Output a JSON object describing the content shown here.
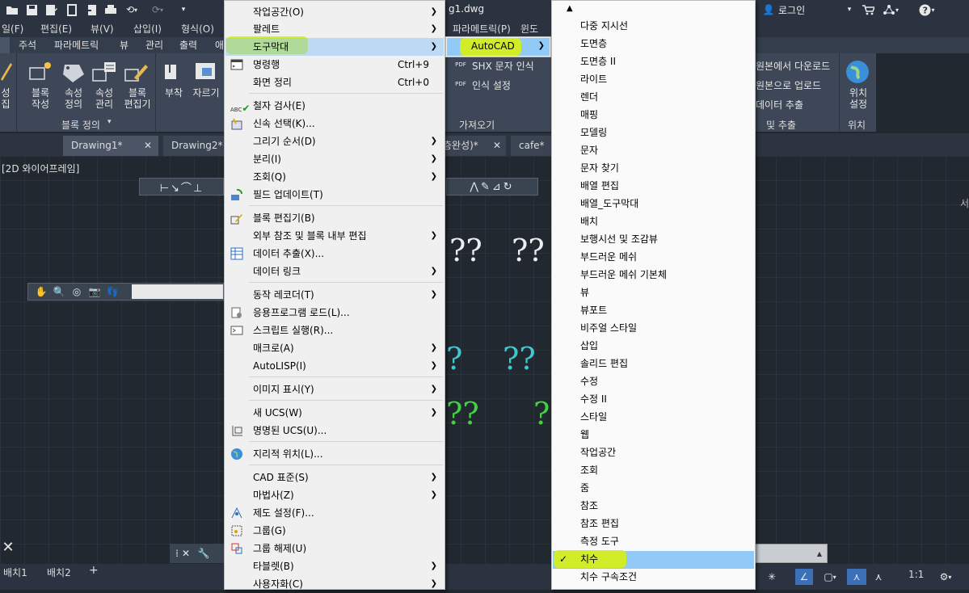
{
  "quickaccess": {
    "icons": [
      "open-icon",
      "save-icon",
      "saveas-icon",
      "export-icon",
      "publish-icon",
      "print-icon",
      "undo-icon",
      "redo-icon",
      "customize-icon"
    ]
  },
  "titlebar": {
    "filename": "g1.dwg",
    "login": "로그인"
  },
  "menubar": {
    "items": [
      "일(F)",
      "편집(E)",
      "뷰(V)",
      "삽입(I)",
      "형식(O)"
    ],
    "right_items": [
      "파라메트릭(P)",
      "윈도"
    ]
  },
  "ribbon_tabs": [
    "주석",
    "파라메트릭",
    "뷰",
    "관리",
    "출력",
    "애"
  ],
  "ribbon": {
    "left_cut": "성\n집",
    "block_group": {
      "buttons": [
        "블록\n작성",
        "속성\n정의",
        "속성\n관리",
        "블록\n편집기"
      ],
      "title": "블록 정의"
    },
    "ref_buttons": [
      "부착",
      "자르기"
    ],
    "import_group": {
      "items": [
        "SHX 문자 인식",
        "인식 설정"
      ],
      "title": "가져오기"
    },
    "data_group": {
      "items": [
        "원본에서 다운로드",
        "원본으로 업로드",
        "데이터 추출"
      ],
      "title": "및 추출"
    },
    "location_group": {
      "button": "위치\n설정",
      "title": "위치"
    }
  },
  "doc_tabs": [
    "Drawing1*",
    "Drawing2*",
    "층완성)*",
    "cafe*"
  ],
  "viewport_label": "[2D 와이어프레임]",
  "layout_tabs": [
    "배치1",
    "배치2"
  ],
  "status": {
    "scale": "1:1"
  },
  "menu1": {
    "items": [
      {
        "label": "작업공간(O)",
        "arrow": true
      },
      {
        "label": "팔레트",
        "arrow": true
      },
      {
        "label": "도구막대",
        "arrow": true,
        "highlight": true
      },
      {
        "label": "명령행",
        "shortcut": "Ctrl+9"
      },
      {
        "label": "화면 정리",
        "shortcut": "Ctrl+0"
      },
      {
        "label": "철자 검사(E)"
      },
      {
        "label": "신속 선택(K)..."
      },
      {
        "label": "그리기 순서(D)",
        "arrow": true
      },
      {
        "label": "분리(I)",
        "arrow": true
      },
      {
        "label": "조회(Q)",
        "arrow": true
      },
      {
        "label": "필드 업데이트(T)"
      },
      {
        "label": "블록 편집기(B)"
      },
      {
        "label": "외부 참조 및 블록 내부 편집",
        "arrow": true
      },
      {
        "label": "데이터 추출(X)..."
      },
      {
        "label": "데이터 링크",
        "arrow": true
      },
      {
        "label": "동작 레코더(T)",
        "arrow": true
      },
      {
        "label": "응용프로그램 로드(L)..."
      },
      {
        "label": "스크립트 실행(R)..."
      },
      {
        "label": "매크로(A)",
        "arrow": true
      },
      {
        "label": "AutoLISP(I)",
        "arrow": true
      },
      {
        "label": "이미지 표시(Y)",
        "arrow": true
      },
      {
        "label": "새 UCS(W)",
        "arrow": true
      },
      {
        "label": "명명된 UCS(U)..."
      },
      {
        "label": "지리적 위치(L)..."
      },
      {
        "label": "CAD 표준(S)",
        "arrow": true
      },
      {
        "label": "마법사(Z)",
        "arrow": true
      },
      {
        "label": "제도 설정(F)..."
      },
      {
        "label": "그룹(G)"
      },
      {
        "label": "그룹 해제(U)"
      },
      {
        "label": "타블렛(B)",
        "arrow": true
      },
      {
        "label": "사용자화(C)",
        "arrow": true
      }
    ]
  },
  "menu2": {
    "item": "AutoCAD"
  },
  "menu3": {
    "items": [
      "다중 지시선",
      "도면층",
      "도면층 II",
      "라이트",
      "렌더",
      "매핑",
      "모델링",
      "문자",
      "문자 찾기",
      "배열 편집",
      "배열_도구막대",
      "배치",
      "보행시선 및 조감뷰",
      "부드러운 메쉬",
      "부드러운 메쉬 기본체",
      "뷰",
      "뷰포트",
      "비주얼 스타일",
      "삽입",
      "솔리드 편집",
      "수정",
      "수정 II",
      "스타일",
      "웹",
      "작업공간",
      "조회",
      "줌",
      "참조",
      "참조 편집",
      "측정 도구",
      "치수",
      "치수 구속조건"
    ],
    "checked": "치수"
  },
  "colors": {
    "highlight": "#91c9f7",
    "marker": "#d5ee1e",
    "cyan": "#3ec8d0",
    "green": "#3fd43f"
  }
}
